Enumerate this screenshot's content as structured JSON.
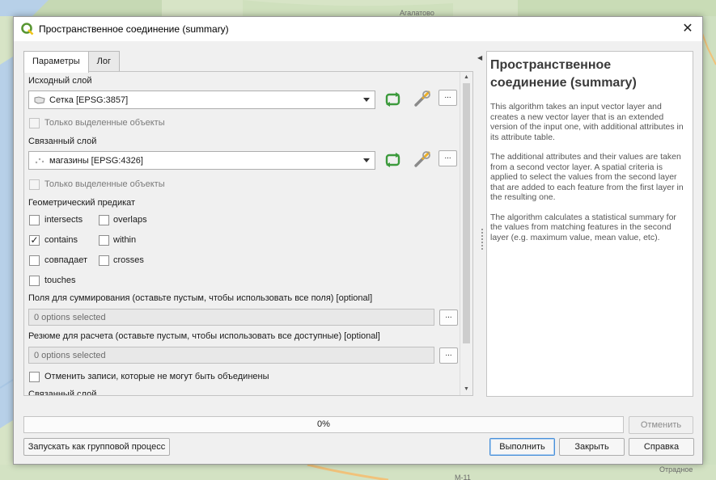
{
  "map": {
    "labels": [
      "Агалатово",
      "Отрадное",
      "M-11"
    ]
  },
  "dialog": {
    "title": "Пространственное соединение (summary)",
    "tabs": [
      "Параметры",
      "Лог"
    ]
  },
  "params": {
    "source_layer_label": "Исходный слой",
    "source_layer_value": "Сетка [EPSG:3857]",
    "source_selected_only": "Только выделенные объекты",
    "join_layer_label": "Связанный слой",
    "join_layer_value": "магазины [EPSG:4326]",
    "join_selected_only": "Только выделенные объекты",
    "predicate_label": "Геометрический предикат",
    "predicates": [
      {
        "label": "intersects",
        "checked": false
      },
      {
        "label": "overlaps",
        "checked": false
      },
      {
        "label": "contains",
        "checked": true
      },
      {
        "label": "within",
        "checked": false
      },
      {
        "label": "совпадает",
        "checked": false
      },
      {
        "label": "crosses",
        "checked": false
      },
      {
        "label": "touches",
        "checked": false
      }
    ],
    "fields_label": "Поля для суммирования (оставьте пустым, чтобы использовать все поля) [optional]",
    "fields_value": "0 options selected",
    "summaries_label": "Резюме для расчета (оставьте пустым, чтобы использовать все доступные) [optional]",
    "summaries_value": "0 options selected",
    "discard_label": "Отменить записи, которые не могут быть объединены",
    "cut_label": "Связанный слой",
    "dots": "..."
  },
  "help": {
    "title": "Пространственное соединение (summary)",
    "paragraphs": [
      "This algorithm takes an input vector layer and creates a new vector layer that is an extended version of the input one, with additional attributes in its attribute table.",
      "The additional attributes and their values are taken from a second vector layer. A spatial criteria is applied to select the values from the second layer that are added to each feature from the first layer in the resulting one.",
      "The algorithm calculates a statistical summary for the values from matching features in the second layer (e.g. maximum value, mean value, etc)."
    ]
  },
  "footer": {
    "progress_text": "0%",
    "progress": 0,
    "cancel": "Отменить",
    "batch": "Запускать как групповой процесс",
    "run": "Выполнить",
    "close": "Закрыть",
    "help": "Справка"
  },
  "colors": {
    "accent": "#4a90d9",
    "qgis_green": "#589632",
    "refresh_green": "#3c9a3c"
  }
}
